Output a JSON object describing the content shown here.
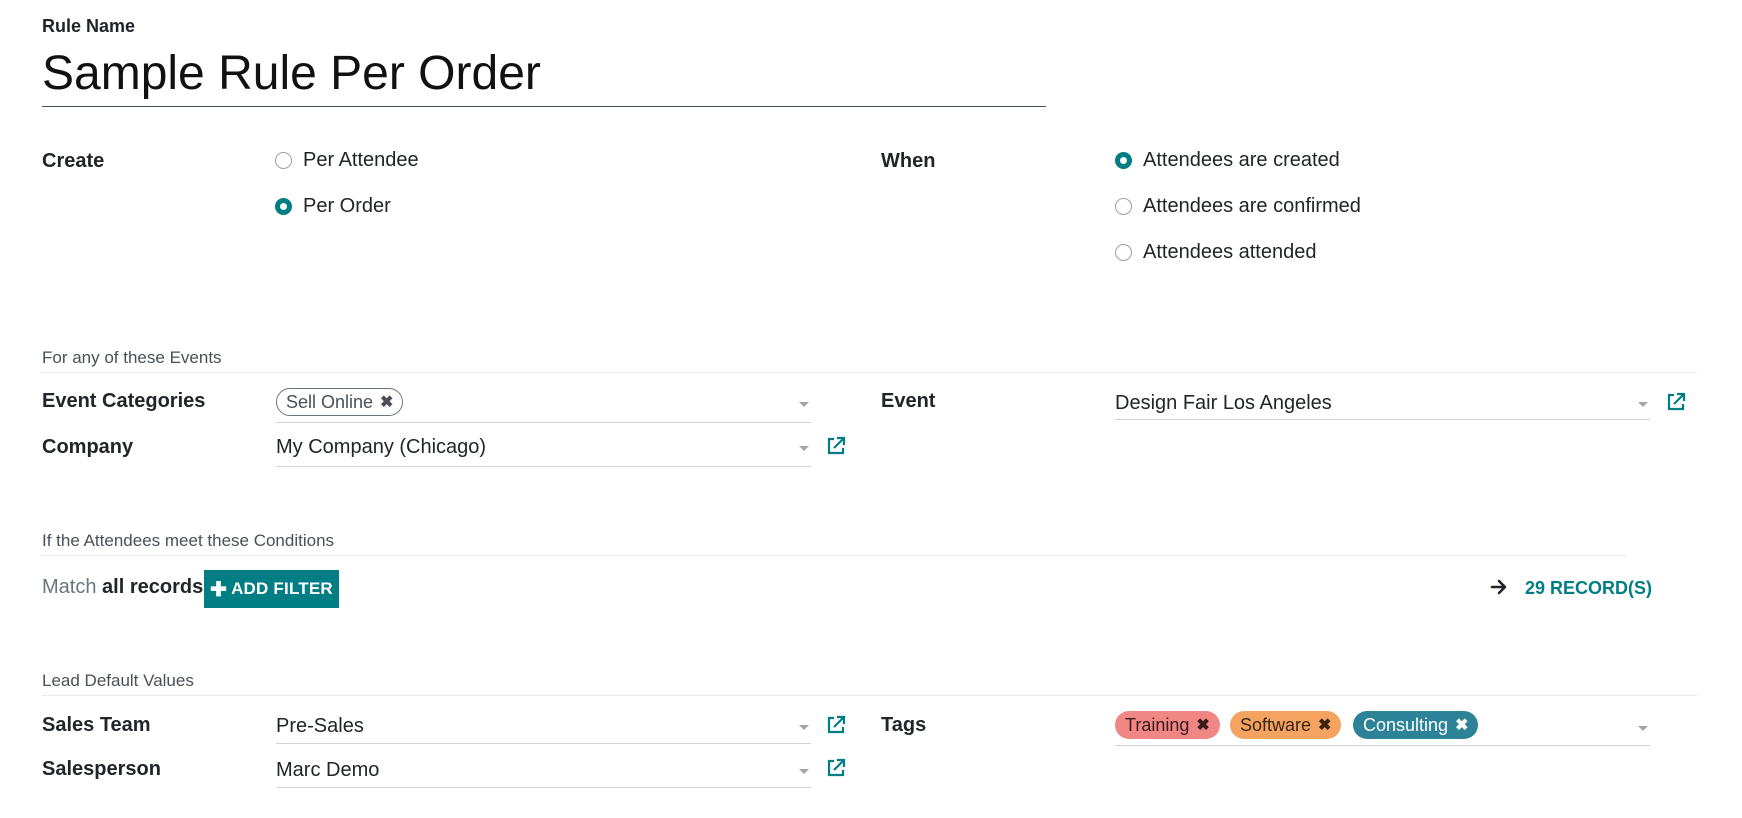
{
  "rule_name": {
    "label": "Rule Name",
    "value": "Sample Rule Per Order"
  },
  "create": {
    "label": "Create",
    "options": [
      {
        "label": "Per Attendee",
        "selected": false
      },
      {
        "label": "Per Order",
        "selected": true
      }
    ]
  },
  "when": {
    "label": "When",
    "options": [
      {
        "label": "Attendees are created",
        "selected": true
      },
      {
        "label": "Attendees are confirmed",
        "selected": false
      },
      {
        "label": "Attendees attended",
        "selected": false
      }
    ]
  },
  "events_section": {
    "title": "For any of these Events",
    "event_categories": {
      "label": "Event Categories",
      "tags": [
        "Sell Online"
      ]
    },
    "company": {
      "label": "Company",
      "value": "My Company (Chicago)"
    },
    "event": {
      "label": "Event",
      "value": "Design Fair Los Angeles"
    }
  },
  "conditions_section": {
    "title": "If the Attendees meet these Conditions",
    "match_prefix": "Match",
    "match_value": "all records",
    "add_filter_label": "ADD FILTER",
    "records_label": "29 RECORD(S)"
  },
  "lead_section": {
    "title": "Lead Default Values",
    "sales_team": {
      "label": "Sales Team",
      "value": "Pre-Sales"
    },
    "salesperson": {
      "label": "Salesperson",
      "value": "Marc Demo"
    },
    "tags": {
      "label": "Tags",
      "items": [
        {
          "label": "Training",
          "color": "#f08784"
        },
        {
          "label": "Software",
          "color": "#f4a460"
        },
        {
          "label": "Consulting",
          "color": "#2c8397"
        }
      ]
    }
  },
  "colors": {
    "accent": "#017e84"
  }
}
